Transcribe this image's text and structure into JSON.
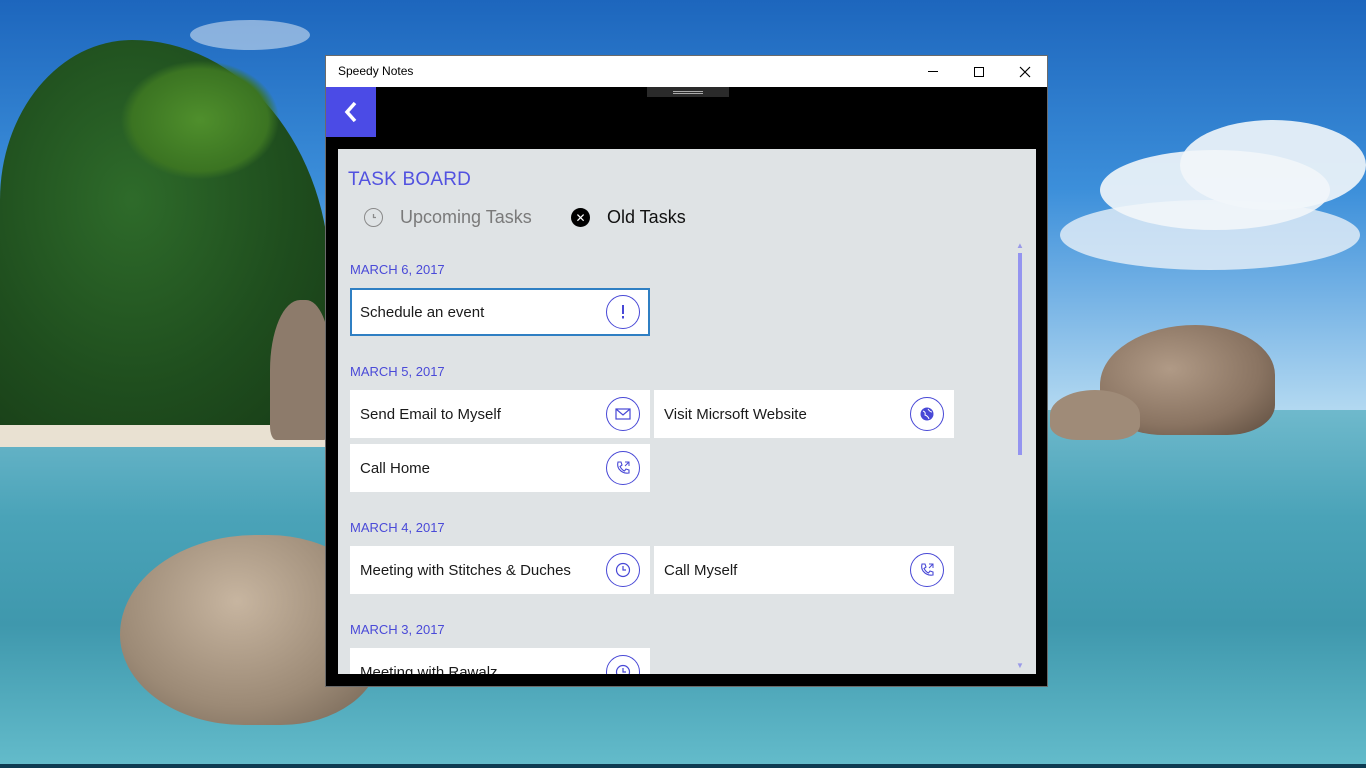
{
  "window": {
    "title": "Speedy Notes",
    "controls": [
      "minimize",
      "maximize",
      "close"
    ]
  },
  "appbar": {
    "back_icon": "chevron-left-icon",
    "accent_color": "#4b4be6"
  },
  "board": {
    "title": "TASK BOARD",
    "tabs": [
      {
        "label": "Upcoming Tasks",
        "icon": "clock-icon",
        "active": false
      },
      {
        "label": "Old Tasks",
        "icon": "close-circle-icon",
        "active": true
      }
    ]
  },
  "groups": [
    {
      "date": "MARCH 6, 2017",
      "tasks": [
        {
          "label": "Schedule an event",
          "icon": "exclamation-icon",
          "selected": true
        }
      ]
    },
    {
      "date": "MARCH 5, 2017",
      "tasks": [
        {
          "label": "Send Email to Myself",
          "icon": "mail-icon"
        },
        {
          "label": "Visit Micrsoft Website",
          "icon": "globe-icon"
        },
        {
          "label": "Call Home",
          "icon": "phone-icon"
        }
      ]
    },
    {
      "date": "MARCH 4, 2017",
      "tasks": [
        {
          "label": "Meeting with Stitches & Duches",
          "icon": "clock-icon"
        },
        {
          "label": "Call Myself",
          "icon": "phone-icon"
        }
      ]
    },
    {
      "date": "MARCH 3, 2017",
      "tasks": [
        {
          "label": "Meeting with Rawalz",
          "icon": "clock-icon"
        }
      ]
    }
  ]
}
